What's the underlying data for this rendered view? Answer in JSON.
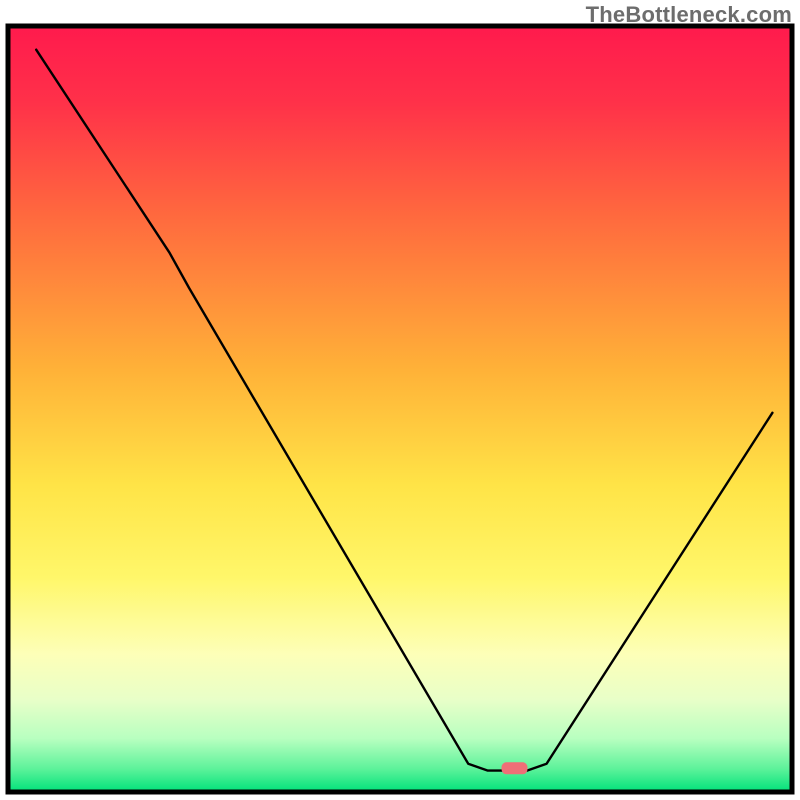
{
  "watermark": "TheBottleneck.com",
  "chart_data": {
    "type": "line",
    "title": "",
    "xlabel": "",
    "ylabel": "",
    "xlim": [
      0,
      100
    ],
    "ylim": [
      0,
      100
    ],
    "grid": false,
    "legend": false,
    "note": "Heat-gradient background with a black V-shaped curve and a small pink marker at the trough. Values below are approximate pixel-space -> percent estimates (no axis ticks or labels are present in the original).",
    "background_gradient_stops": [
      {
        "pos": 0.0,
        "color": "#ff1a4d"
      },
      {
        "pos": 0.1,
        "color": "#ff3149"
      },
      {
        "pos": 0.25,
        "color": "#ff6a3e"
      },
      {
        "pos": 0.45,
        "color": "#ffb238"
      },
      {
        "pos": 0.6,
        "color": "#ffe447"
      },
      {
        "pos": 0.72,
        "color": "#fff76a"
      },
      {
        "pos": 0.82,
        "color": "#fdffb8"
      },
      {
        "pos": 0.88,
        "color": "#e8ffc8"
      },
      {
        "pos": 0.93,
        "color": "#b8ffc0"
      },
      {
        "pos": 0.97,
        "color": "#5cf29a"
      },
      {
        "pos": 1.0,
        "color": "#00e27a"
      }
    ],
    "curve_points_percent": [
      {
        "x": 3.6,
        "y": 96.9
      },
      {
        "x": 20.6,
        "y": 70.4
      },
      {
        "x": 23.1,
        "y": 65.8
      },
      {
        "x": 58.7,
        "y": 3.7
      },
      {
        "x": 61.2,
        "y": 2.8
      },
      {
        "x": 66.2,
        "y": 2.8
      },
      {
        "x": 68.7,
        "y": 3.7
      },
      {
        "x": 97.5,
        "y": 49.5
      }
    ],
    "marker_percent": {
      "x": 64.6,
      "y": 3.1
    },
    "marker_color": "#ef6f77",
    "plot_border_color": "#000000"
  }
}
